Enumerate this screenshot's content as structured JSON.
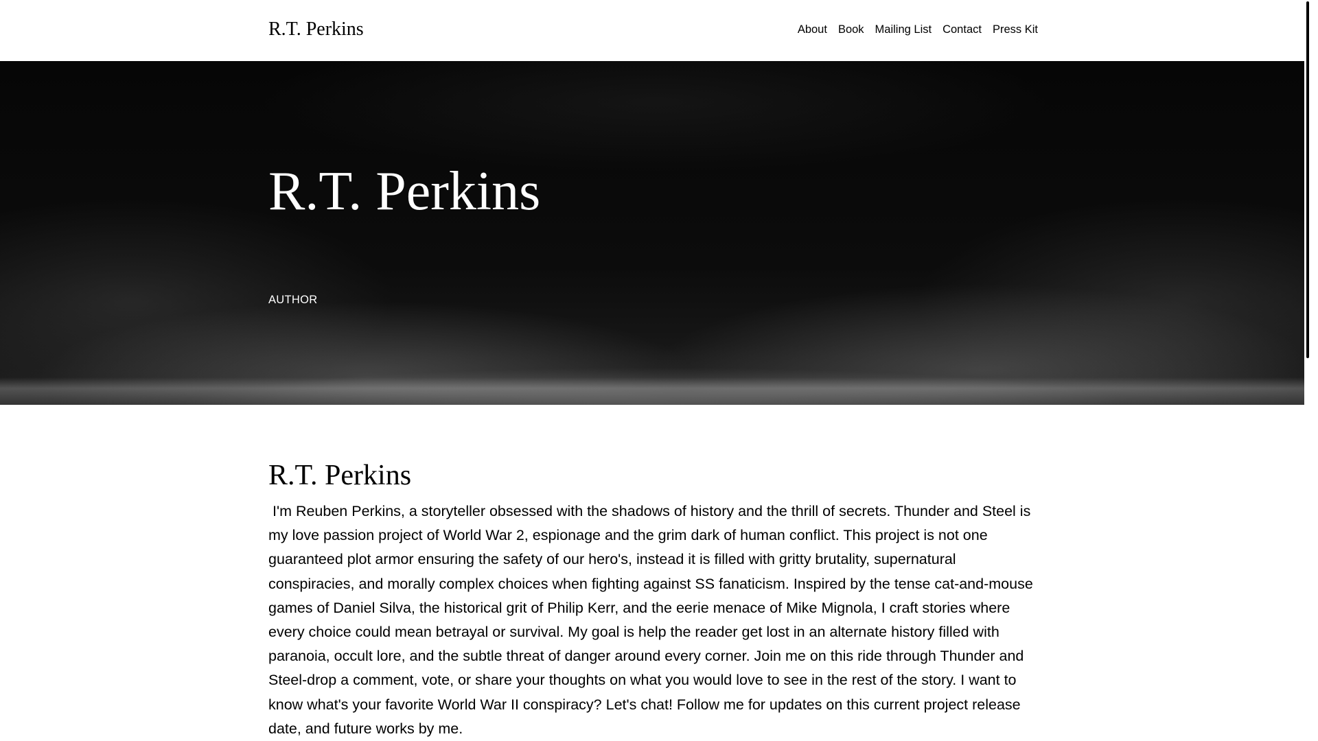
{
  "header": {
    "site_title": "R.T. Perkins",
    "nav": {
      "about": "About",
      "book": "Book",
      "mailing_list": "Mailing List",
      "contact": "Contact",
      "press_kit": "Press Kit"
    }
  },
  "hero": {
    "title": "R.T. Perkins",
    "subtitle": "AUTHOR"
  },
  "main": {
    "title": "R.T. Perkins",
    "body": " I'm Reuben Perkins, a storyteller obsessed with the shadows of history and the thrill of secrets. Thunder and Steel is my love passion project of World War 2, espionage and the grim dark of human conflict. This project is not one guaranteed plot armor ensuring the safety of our hero's, instead it is filled with gritty brutality, supernatural conspiracies, and morally complex choices when fighting against SS fanaticism. Inspired by the tense cat-and-mouse games of Daniel Silva, the historical grit of Philip Kerr, and the eerie menace of Mike Mignola, I craft stories where every choice could mean betrayal or survival. My goal is help the reader get lost in an alternate history filled with paranoia, occult lore, and the subtle threat of danger around every corner. Join me on this ride through Thunder and Steel-drop a comment, vote, or share your thoughts on what you would love to see in the rest of the story. I want to know what's your favorite World War II conspiracy? Let's chat! Follow me for updates on this current project release date, and future works by me."
  },
  "colors": {
    "header_bg": "#ffffff",
    "hero_bg": "#0a0a0a",
    "text": "#000000",
    "hero_text": "#ffffff"
  }
}
